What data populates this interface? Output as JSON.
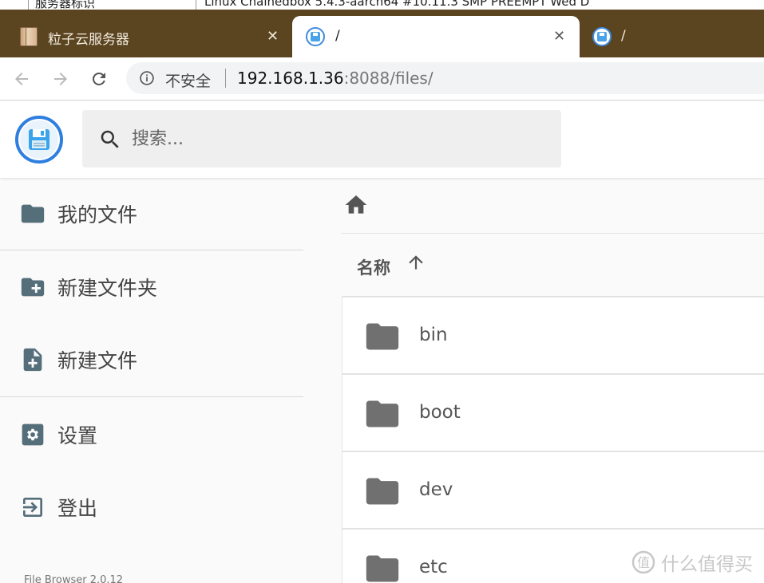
{
  "background_strip": {
    "left_text": "服务器标识",
    "right_text": "Linux Chainedbox 5.4.3-aarch64 #10.11.3 SMP PREEMPT Wed D"
  },
  "tabs": [
    {
      "title": "粒子云服务器",
      "close": "✕",
      "icon": "book-icon",
      "state": "inactive"
    },
    {
      "title": "/",
      "close": "✕",
      "icon": "filebrowser-favicon",
      "state": "active"
    },
    {
      "title": "/",
      "icon": "filebrowser-favicon",
      "state": "inactive"
    }
  ],
  "addressbar": {
    "security_label": "不安全",
    "url_host": "192.168.1.36",
    "url_rest": ":8088/files/"
  },
  "search": {
    "placeholder": "搜索..."
  },
  "sidebar": {
    "items": [
      {
        "label": "我的文件",
        "icon": "folder-icon"
      },
      {
        "label": "新建文件夹",
        "icon": "create-new-folder-icon"
      },
      {
        "label": "新建文件",
        "icon": "note-add-icon"
      },
      {
        "label": "设置",
        "icon": "settings-icon"
      },
      {
        "label": "登出",
        "icon": "exit-icon"
      }
    ],
    "version": "File Browser 2.0.12"
  },
  "listing": {
    "column_name": "名称",
    "sort": "ascending",
    "files": [
      {
        "name": "bin"
      },
      {
        "name": "boot"
      },
      {
        "name": "dev"
      },
      {
        "name": "etc"
      }
    ]
  },
  "watermark": {
    "text": "什么值得买"
  },
  "colors": {
    "tabbar": "#5b4420",
    "accent": "#2f7fe0",
    "icon_gray": "#546e7a",
    "folder_gray": "#707070"
  }
}
